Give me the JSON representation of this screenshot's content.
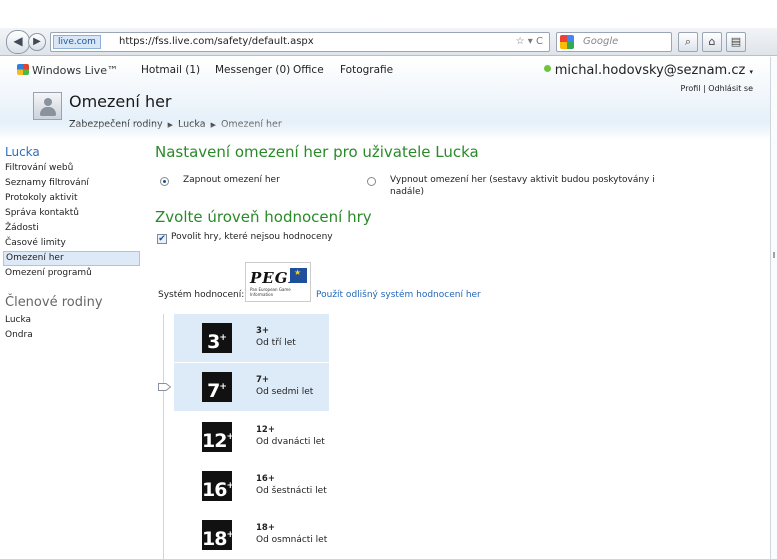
{
  "browser": {
    "site_badge": "live.com",
    "url": "https://fss.live.com/safety/default.aspx",
    "search_placeholder": "Google"
  },
  "header": {
    "brand": "Windows Live™",
    "nav": [
      "Hotmail (1)",
      "Messenger (0)",
      "Office",
      "Fotografie"
    ],
    "user_email": "michal.hodovsky@seznam.cz",
    "user_links": "Profil | Odhlásit se",
    "page_title": "Omezení her",
    "breadcrumb": [
      "Zabezpečení rodiny",
      "Lucka",
      "Omezení her"
    ]
  },
  "sidebar": {
    "owner": "Lucka",
    "items": [
      "Filtrování webů",
      "Seznamy filtrování",
      "Protokoly aktivit",
      "Správa kontaktů",
      "Žádosti",
      "Časové limity",
      "Omezení her",
      "Omezení programů"
    ],
    "active_index": 6,
    "family_title": "Členové rodiny",
    "family": [
      "Lucka",
      "Ondra"
    ]
  },
  "main": {
    "heading": "Nastavení omezení her pro uživatele Lucka",
    "option_on": "Zapnout omezení her",
    "option_off": "Vypnout omezení her (sestavy aktivit budou poskytovány i nadále)",
    "selected_option": "on",
    "rating_heading": "Zvolte úroveň hodnocení hry",
    "allow_unrated": "Povolit hry, které nejsou hodnoceny",
    "allow_unrated_checked": true,
    "system_label": "Systém hodnocení:",
    "system_logo": "PEGI",
    "system_logo_tagline": "Pan European Game Information",
    "alt_system_link": "Použít odlišný systém hodnocení her"
  },
  "ratings": [
    {
      "badge": "3",
      "code": "3+",
      "desc": "Od tří let",
      "selected": true
    },
    {
      "badge": "7",
      "code": "7+",
      "desc": "Od sedmi let",
      "selected": true
    },
    {
      "badge": "12",
      "code": "12+",
      "desc": "Od dvanácti let",
      "selected": false
    },
    {
      "badge": "16",
      "code": "16+",
      "desc": "Od šestnácti let",
      "selected": false
    },
    {
      "badge": "18",
      "code": "18+",
      "desc": "Od osmnácti let",
      "selected": false
    }
  ]
}
